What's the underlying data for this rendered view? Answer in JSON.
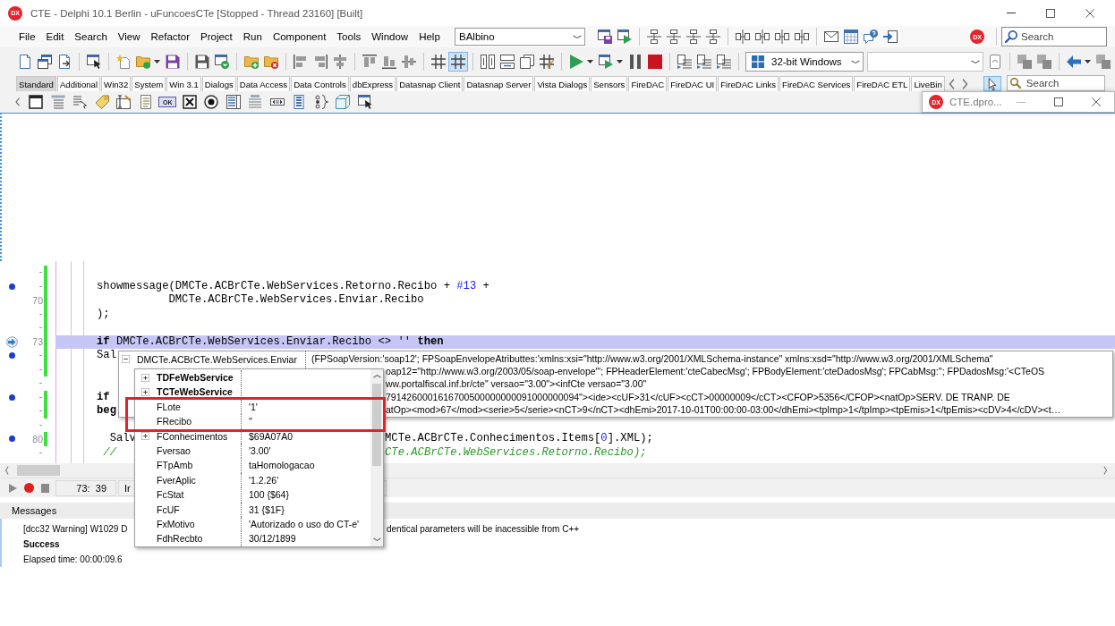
{
  "window": {
    "logo": "DX",
    "title": "CTE - Delphi 10.1 Berlin - uFuncoesCTe [Stopped - Thread 23160] [Built]"
  },
  "menu": [
    "File",
    "Edit",
    "Search",
    "View",
    "Refactor",
    "Project",
    "Run",
    "Component",
    "Tools",
    "Window",
    "Help"
  ],
  "toolbar": {
    "layout_combo": "BAlbino",
    "logo": "DX",
    "search": {
      "placeholder": "Search"
    },
    "grid_button_on": true,
    "platform_combo": "32-bit Windows"
  },
  "palette": {
    "tabs": [
      {
        "label": "Standard",
        "selected": true
      },
      {
        "label": "Additional",
        "selected": false
      },
      {
        "label": "Win32",
        "selected": false
      },
      {
        "label": "System",
        "selected": false
      },
      {
        "label": "Win 3.1",
        "selected": false
      },
      {
        "label": "Dialogs",
        "selected": false
      },
      {
        "label": "Data Access",
        "selected": false
      },
      {
        "label": "Data Controls",
        "selected": false
      },
      {
        "label": "dbExpress",
        "selected": false
      },
      {
        "label": "Datasnap Client",
        "selected": false
      },
      {
        "label": "Datasnap Server",
        "selected": false
      },
      {
        "label": "Vista Dialogs",
        "selected": false
      },
      {
        "label": "Sensors",
        "selected": false
      },
      {
        "label": "FireDAC",
        "selected": false
      },
      {
        "label": "FireDAC UI",
        "selected": false
      },
      {
        "label": "FireDAC Links",
        "selected": false
      },
      {
        "label": "FireDAC Services",
        "selected": false
      },
      {
        "label": "FireDAC ETL",
        "selected": false
      },
      {
        "label": "LiveBin",
        "selected": false
      }
    ],
    "pointer_tool_selected": true,
    "search": {
      "placeholder": "Search"
    },
    "button_icon_label": "OK"
  },
  "child_window": {
    "logo": "DX",
    "title": "CTE.dpro..."
  },
  "editor": {
    "lines": [
      {
        "dot": false,
        "current": false,
        "modified": true
      },
      {
        "dot": true,
        "current": false,
        "modified": true,
        "code": [
          {
            "kind": "plain",
            "text": "showmessage(DMCTe.ACBrCTe.WebServices.Retorno.Recibo + "
          },
          {
            "kind": "number",
            "text": "#13"
          },
          {
            "kind": "plain",
            "text": " +"
          }
        ]
      },
      {
        "number": "70",
        "dot": false,
        "current": false,
        "modified": true,
        "code": [
          {
            "kind": "plain",
            "text": "           DMCTe.ACBrCTe.WebServices.Enviar.Recibo"
          }
        ]
      },
      {
        "dot": false,
        "current": false,
        "modified": true,
        "code": [
          {
            "kind": "plain",
            "text": ");"
          }
        ]
      },
      {
        "dot": false,
        "current": false,
        "modified": true
      },
      {
        "number": "73",
        "dot": false,
        "current": true,
        "modified": true,
        "code": [
          {
            "kind": "keyword",
            "text": "if"
          },
          {
            "kind": "plain",
            "text": " DMCTe.ACBrCTe.WebServices.Enviar.Recibo <> '' "
          },
          {
            "kind": "keyword",
            "text": "then"
          }
        ]
      },
      {
        "dot": true,
        "current": false,
        "modified": true,
        "code": [
          {
            "kind": "plain",
            "text": "Sal"
          }
        ]
      },
      {
        "dot": false,
        "current": false,
        "modified": true
      },
      {
        "dot": false,
        "current": false,
        "modified": false
      },
      {
        "dot": true,
        "current": false,
        "modified": true,
        "code": [
          {
            "kind": "keyword",
            "text": "if"
          }
        ]
      },
      {
        "dot": false,
        "current": false,
        "modified": true,
        "code": [
          {
            "kind": "keyword",
            "text": "beg"
          }
        ]
      },
      {
        "dot": false,
        "current": false,
        "modified": false
      },
      {
        "number": "80",
        "dot": true,
        "current": false,
        "modified": true,
        "code": [
          {
            "kind": "plain",
            "text": "  Salv"
          }
        ],
        "code_right": [
          {
            "kind": "plain",
            "text": "MCTe.ACBrCTe.Conhecimentos.Items["
          },
          {
            "kind": "number",
            "text": "0"
          },
          {
            "kind": "plain",
            "text": "].XML);"
          }
        ]
      },
      {
        "dot": false,
        "current": false,
        "modified": false,
        "code": [
          {
            "kind": "comment",
            "text": " //"
          }
        ],
        "code_right": [
          {
            "kind": "comment",
            "text": "CTe.ACBrCTe.WebServices.Retorno.Recibo);"
          }
        ]
      }
    ]
  },
  "status_bar": {
    "position": "73:  39",
    "panel_2": "Ir"
  },
  "messages": {
    "title": "Messages",
    "items": [
      {
        "kind": "warning",
        "visible_parts": [
          "[dcc32 Warning] W1029 D",
          "dentical parameters will be inacessible from C++"
        ]
      },
      {
        "kind": "success",
        "text": "Success"
      },
      {
        "kind": "info",
        "text": "Elapsed time: 00:00:09.6"
      }
    ]
  },
  "evaluator": {
    "expression": "DMCTe.ACBrCTe.WebServices.Enviar",
    "expanded": true,
    "value": {
      "first_line": "(FPSoapVersion:'soap12'; FPSoapEnvelopeAtributtes:'xmlns:xsi=\"http://www.w3.org/2001/XMLSchema-instance\" xmlns:xsd=\"http://www.w3.org/2001/XMLSchema\"",
      "partly_hidden_lines": [
        "oap12=\"http://www.w3.org/2003/05/soap-envelope\"'; FPHeaderElement:'cteCabecMsg'; FPBodyElement:'cteDadosMsg'; FPCabMsg:''; FPDadosMsg:'<CTeOS",
        "ww.portalfiscal.inf.br/cte\" versao=\"3.00\"><infCte versao=\"3.00\"",
        "7914260001616700500000000091000000094\"><ide><cUF>31</cUF><cCT>00000009</cCT><CFOP>5356</CFOP><natOp>SERV. DE TRANP. DE",
        "atOp><mod>67</mod><serie>5</serie><nCT>9</nCT><dhEmi>2017-10-01T00:00:00-03:00</dhEmi><tpImp>1</tpImp><tpEmis>1</tpEmis><cDV>4</cDV><t…"
      ]
    },
    "fields": [
      {
        "name": "TDFeWebService",
        "kind": "ancestor",
        "expandable": true,
        "highlighted": false
      },
      {
        "name": "TCTeWebService",
        "kind": "ancestor",
        "expandable": true,
        "highlighted": false
      },
      {
        "name": "FLote",
        "value": "'1'",
        "kind": "field",
        "expandable": false,
        "highlighted": true
      },
      {
        "name": "FRecibo",
        "value": "''",
        "kind": "field",
        "expandable": false,
        "highlighted": true
      },
      {
        "name": "FConhecimentos",
        "value": "$69A07A0",
        "kind": "field",
        "expandable": true,
        "highlighted": false
      },
      {
        "name": "Fversao",
        "value": "'3.00'",
        "kind": "field",
        "expandable": false,
        "highlighted": false
      },
      {
        "name": "FTpAmb",
        "value": "taHomologacao",
        "kind": "field",
        "expandable": false,
        "highlighted": false
      },
      {
        "name": "FverAplic",
        "value": "'1.2.26'",
        "kind": "field",
        "expandable": false,
        "highlighted": false
      },
      {
        "name": "FcStat",
        "value": "100 {$64}",
        "kind": "field",
        "expandable": false,
        "highlighted": false
      },
      {
        "name": "FcUF",
        "value": "31 {$1F}",
        "kind": "field",
        "expandable": false,
        "highlighted": false
      },
      {
        "name": "FxMotivo",
        "value": "'Autorizado o uso do CT-e'",
        "kind": "field",
        "expandable": false,
        "highlighted": false
      },
      {
        "name": "FdhRecbto",
        "value": "30/12/1899",
        "kind": "field",
        "expandable": false,
        "highlighted": false
      }
    ]
  }
}
